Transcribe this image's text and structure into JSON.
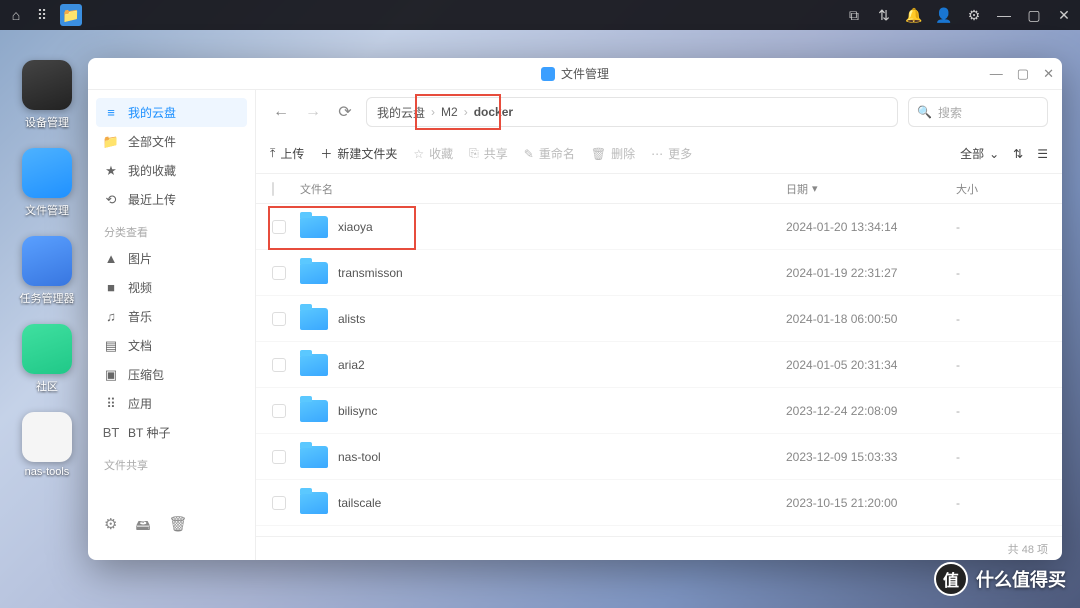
{
  "taskbar": {},
  "dock": [
    {
      "label": "设备管理",
      "cls": "di-device"
    },
    {
      "label": "文件管理",
      "cls": "di-file"
    },
    {
      "label": "任务管理器",
      "cls": "di-task"
    },
    {
      "label": "社区",
      "cls": "di-comm"
    },
    {
      "label": "nas-tools",
      "cls": "di-nas"
    }
  ],
  "window": {
    "title": "文件管理"
  },
  "sidebar": {
    "sec1_label": "分类查看",
    "sec2_label": "文件共享",
    "items_top": [
      {
        "label": "我的云盘",
        "icon": "≡",
        "active": true
      },
      {
        "label": "全部文件",
        "icon": "📁"
      },
      {
        "label": "我的收藏",
        "icon": "★"
      },
      {
        "label": "最近上传",
        "icon": "⟲"
      }
    ],
    "items_cat": [
      {
        "label": "图片",
        "icon": "▲"
      },
      {
        "label": "视频",
        "icon": "■"
      },
      {
        "label": "音乐",
        "icon": "♫"
      },
      {
        "label": "文档",
        "icon": "▤"
      },
      {
        "label": "压缩包",
        "icon": "▣"
      },
      {
        "label": "应用",
        "icon": "⠿"
      },
      {
        "label": "BT 种子",
        "icon": "BT"
      }
    ]
  },
  "breadcrumb": {
    "root": "我的云盘",
    "p1": "M2",
    "p2": "docker"
  },
  "search": {
    "placeholder": "搜索"
  },
  "actions": {
    "upload": "上传",
    "newfolder": "新建文件夹",
    "fav": "收藏",
    "share": "共享",
    "rename": "重命名",
    "delete": "删除",
    "more": "更多",
    "filter": "全部"
  },
  "columns": {
    "name": "文件名",
    "date": "日期",
    "size": "大小"
  },
  "files": [
    {
      "name": "xiaoya",
      "date": "2024-01-20 13:34:14",
      "size": "-"
    },
    {
      "name": "transmisson",
      "date": "2024-01-19 22:31:27",
      "size": "-"
    },
    {
      "name": "alists",
      "date": "2024-01-18 06:00:50",
      "size": "-"
    },
    {
      "name": "aria2",
      "date": "2024-01-05 20:31:34",
      "size": "-"
    },
    {
      "name": "bilisync",
      "date": "2023-12-24 22:08:09",
      "size": "-"
    },
    {
      "name": "nas-tool",
      "date": "2023-12-09 15:03:33",
      "size": "-"
    },
    {
      "name": "tailscale",
      "date": "2023-10-15 21:20:00",
      "size": "-"
    }
  ],
  "footer": {
    "count": "共 48 项"
  },
  "watermark": {
    "text": "什么值得买"
  }
}
